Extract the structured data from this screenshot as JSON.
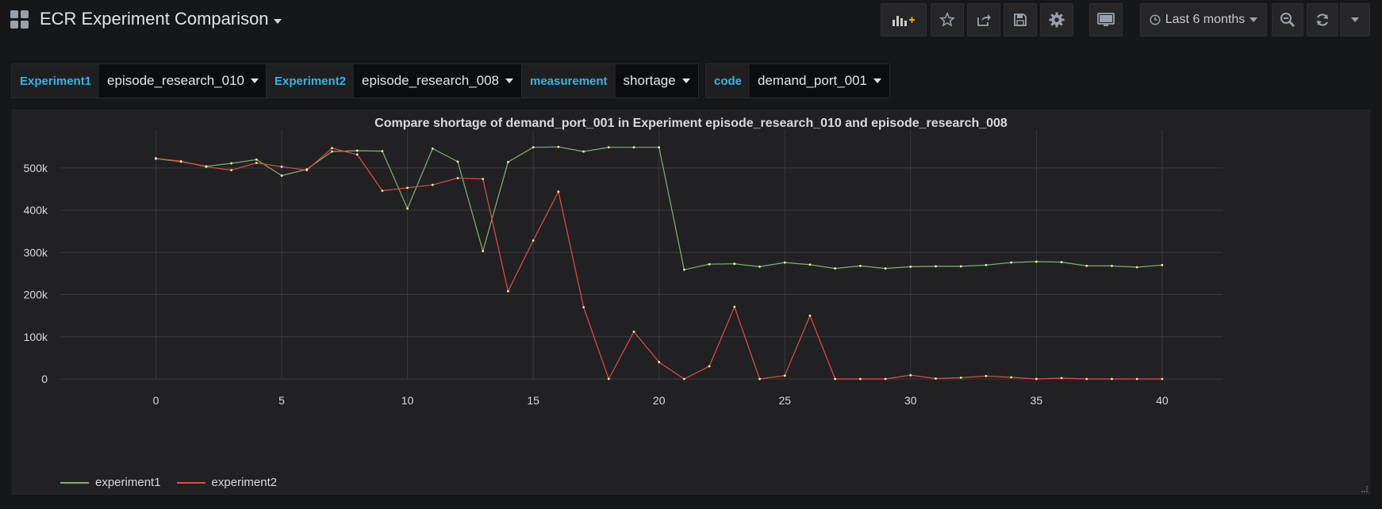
{
  "header": {
    "title": "ECR Experiment Comparison",
    "time_range": "Last 6 months"
  },
  "icons": {
    "dashboard": "apps-grid-icon",
    "add_panel": "add-panel-icon",
    "star": "star-icon",
    "share": "share-icon",
    "save": "save-icon",
    "settings": "gear-icon",
    "tv_mode": "monitor-icon",
    "clock": "clock-icon",
    "zoom_out": "zoom-out-icon",
    "refresh": "refresh-icon"
  },
  "colors": {
    "background": "#161719",
    "panel": "#212124",
    "variable_label": "#33b5e5",
    "add_panel_accent": "#f5a623",
    "series1": "#7eb26d",
    "series2": "#e24d42"
  },
  "variables": [
    {
      "label": "Experiment1",
      "value": "episode_research_010"
    },
    {
      "label": "Experiment2",
      "value": "episode_research_008"
    },
    {
      "label": "measurement",
      "value": "shortage"
    },
    {
      "label": "code",
      "value": "demand_port_001"
    }
  ],
  "panel": {
    "title": "Compare shortage of demand_port_001 in Experiment episode_research_010 and episode_research_008"
  },
  "chart_data": {
    "type": "line",
    "title": "Compare shortage of demand_port_001 in Experiment episode_research_010 and episode_research_008",
    "xlabel": "",
    "ylabel": "",
    "x": [
      0,
      1,
      2,
      3,
      4,
      5,
      6,
      7,
      8,
      9,
      10,
      11,
      12,
      13,
      14,
      15,
      16,
      17,
      18,
      19,
      20,
      21,
      22,
      23,
      24,
      25,
      26,
      27,
      28,
      29,
      30,
      31,
      32,
      33,
      34,
      35,
      36,
      37,
      38,
      39,
      40
    ],
    "xticks": [
      0,
      5,
      10,
      15,
      20,
      25,
      30,
      35,
      40
    ],
    "yticks": [
      0,
      100000,
      200000,
      300000,
      400000,
      500000
    ],
    "ytick_labels": [
      "0",
      "100k",
      "200k",
      "300k",
      "400k",
      "500k"
    ],
    "xlim": [
      -3.8,
      42.4
    ],
    "ylim": [
      0,
      590000
    ],
    "grid": true,
    "legend_position": "bottom-left",
    "series": [
      {
        "name": "experiment1",
        "color": "#7eb26d",
        "values": [
          522000,
          515000,
          504000,
          511000,
          520000,
          482000,
          497000,
          539000,
          541000,
          540000,
          404000,
          546000,
          515000,
          303000,
          514000,
          549000,
          550000,
          539000,
          549000,
          549000,
          549000,
          259000,
          272000,
          273000,
          266000,
          276000,
          271000,
          262000,
          268000,
          262000,
          266000,
          267000,
          267000,
          270000,
          276000,
          278000,
          277000,
          268000,
          268000,
          265000,
          270000
        ]
      },
      {
        "name": "experiment2",
        "color": "#e24d42",
        "values": [
          523000,
          516000,
          503000,
          495000,
          512000,
          503000,
          495000,
          547000,
          532000,
          446000,
          453000,
          460000,
          476000,
          474000,
          208000,
          328000,
          444000,
          170000,
          0,
          112000,
          40000,
          0,
          30000,
          171000,
          0,
          8000,
          150000,
          0,
          0,
          0,
          9000,
          1000,
          3000,
          7000,
          4000,
          0,
          2000,
          0,
          0,
          0,
          0
        ]
      }
    ]
  }
}
